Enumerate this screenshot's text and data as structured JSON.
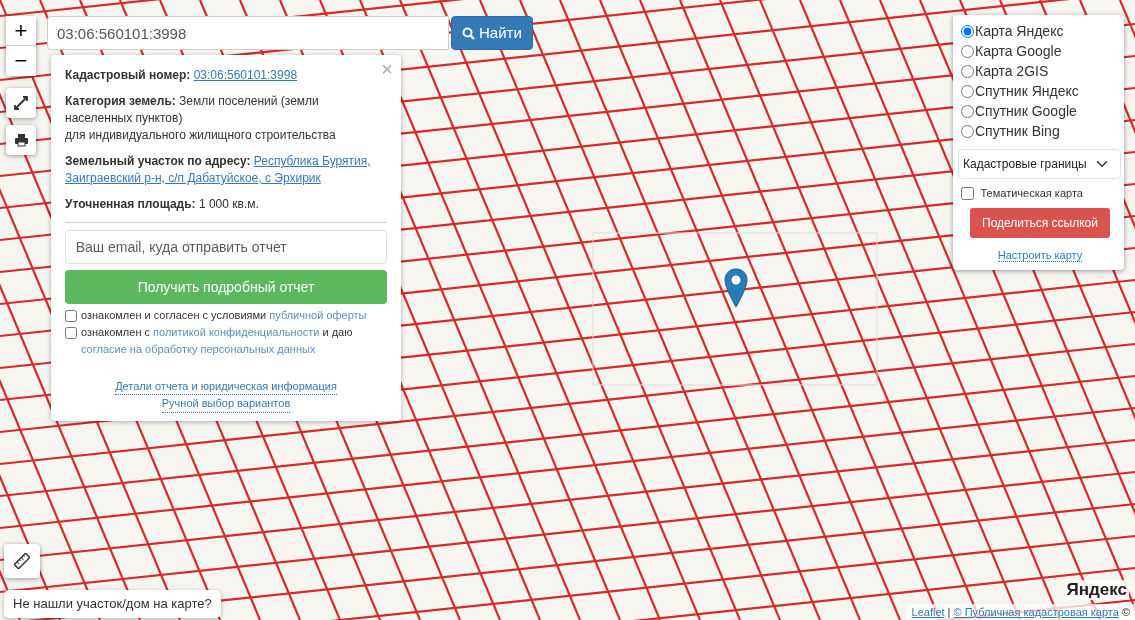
{
  "search": {
    "value": "03:06:560101:3998",
    "button": "Найти"
  },
  "zoom": {
    "in": "+",
    "out": "−"
  },
  "popup": {
    "close": "×",
    "cadastral": {
      "label": "Кадастровый номер:",
      "value": "03:06:560101:3998"
    },
    "category": {
      "label": "Категория земель:",
      "value": "Земли поселений (земли населенных пунктов)",
      "use": "для индивидуального жилищного строительства"
    },
    "address": {
      "label": "Земельный участок по адресу:",
      "lines": [
        "Республика Бурятия,",
        "Заиграевский р-н, с/п Дабатуйское, с Эрхирик"
      ]
    },
    "area": {
      "label": "Уточненная площадь:",
      "value": "1 000 кв.м."
    },
    "email": {
      "placeholder": "Ваш email, куда отправить отчет"
    },
    "submit": "Получить подробный отчет",
    "agreements": [
      {
        "checked": false,
        "parts": [
          {
            "text": "ознакомлен и согласен с условиями ",
            "link": false
          },
          {
            "text": "публичной оферты",
            "link": true
          }
        ]
      },
      {
        "checked": false,
        "parts": [
          {
            "text": "ознакомлен с ",
            "link": false
          },
          {
            "text": "политикой конфиденциальности",
            "link": true
          },
          {
            "text": " и даю ",
            "link": false
          },
          {
            "text": "согласие на обработку персональных данных",
            "link": true
          }
        ]
      }
    ],
    "links": [
      "Детали отчета и юридическая информация",
      "Ручной выбор вариантов"
    ]
  },
  "layers": {
    "options": [
      {
        "label": "Карта Яндекс",
        "selected": true
      },
      {
        "label": "Карта Google",
        "selected": false
      },
      {
        "label": "Карта 2GIS",
        "selected": false
      },
      {
        "label": "Спутник Яндекс",
        "selected": false
      },
      {
        "label": "Спутник Google",
        "selected": false
      },
      {
        "label": "Спутник Bing",
        "selected": false
      }
    ],
    "overlay": "Кадастровые границы",
    "thematic": {
      "label": "Тематическая карта",
      "checked": false
    },
    "share": "Поделиться ссылкой",
    "configure": "Настроить карту"
  },
  "not_found": "Не нашли участок/дом на карте?",
  "provider_logo": "Яндекс",
  "attribution": {
    "leaflet": "Leaflet",
    "separator": "|",
    "source": "© Публичная кадастровая карта",
    "tail": "©"
  }
}
